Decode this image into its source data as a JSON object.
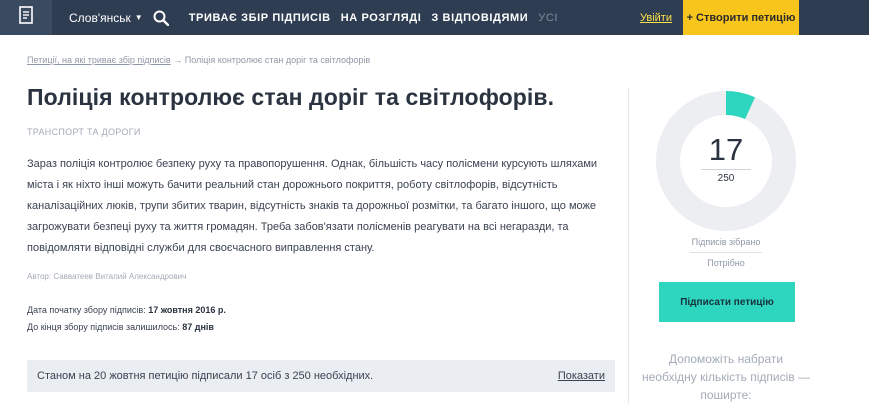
{
  "nav": {
    "city": "Слов'янськ",
    "tabs": [
      {
        "label": "триває збір підписів",
        "active": true
      },
      {
        "label": "на розгляді",
        "active": true
      },
      {
        "label": "з відповідями",
        "active": true
      },
      {
        "label": "усі",
        "active": false
      }
    ],
    "login": "Увійти",
    "create": "+ Створити петицію"
  },
  "breadcrumb": {
    "link": "Петиції, на які триває збір підписів",
    "separator": "→",
    "current": "Поліція контролює стан доріг та світлофорів"
  },
  "petition": {
    "title": "Поліція контролює стан доріг та світлофорів.",
    "category": "Транспорт та дороги",
    "body": "Зараз поліція контролює безпеку руху та правопорушення. Однак, більшість часу полісмени курсують шляхами міста і як ніхто інші можуть бачити реальний стан дорожнього покриття, роботу світлофорів, відсутність каналізаційних люків, трупи збитих тварин, відсутність знаків та дорожньої розмітки, та багато іншого, що може загрожувати безпеці руху та життя громадян. Треба забов'язати полісменів реагувати на всі негаразди, та повідомляти відповідні служби для своєчасного виправлення стану.",
    "author": "Автор: Савватеев Виталий Александрович",
    "start_label": "Дата початку збору підписів:",
    "start_value": "17 жовтня 2016 р.",
    "remaining_label": "До кінця збору підписів залишилось:",
    "remaining_value": "87 днів"
  },
  "status": {
    "text": "Станом на 20 жовтня петицію підписали 17 осіб з 250 необхідних.",
    "show": "Показати"
  },
  "sidebar": {
    "count": "17",
    "total": "250",
    "progress": 0.068,
    "collected_label": "Підписів зібрано",
    "needed_label": "Потрібно",
    "sign_button": "Підписати петицію",
    "help_text": "Допоможіть набрати необхідну кількість підписів — поширте:"
  },
  "colors": {
    "topbar": "#2f3d52",
    "create_button": "#f7c51b",
    "login_link": "#ffe14a",
    "sign_button": "#2fd6bf",
    "gauge_fill": "#2fd6bf",
    "gauge_track": "#eceef1"
  },
  "icons": {
    "logo": "document-icon",
    "search": "search-icon",
    "caret": "chevron-down-icon"
  }
}
